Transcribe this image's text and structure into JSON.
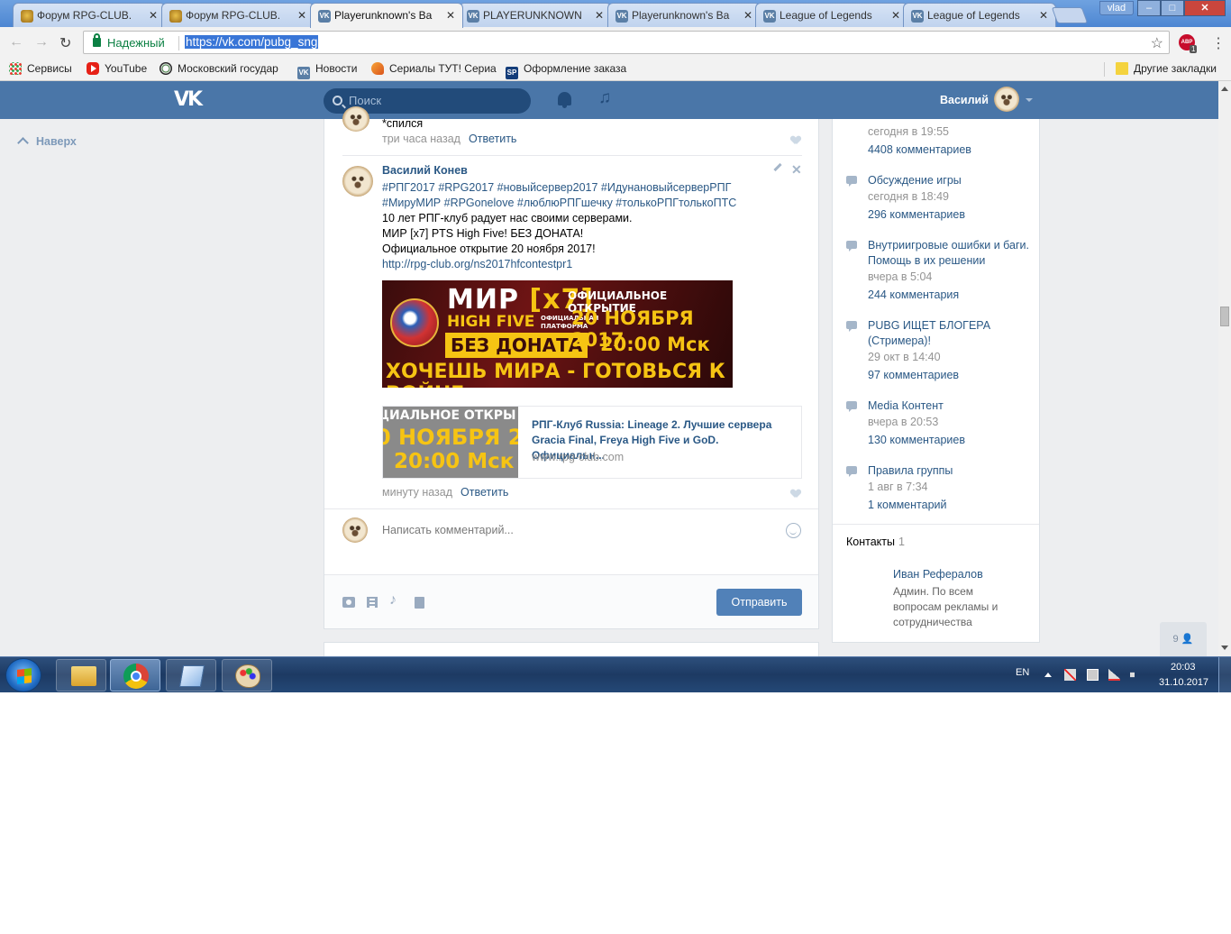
{
  "browser": {
    "tabs": [
      {
        "title": "Форум RPG-CLUB.",
        "icon": "rpg-club-icon"
      },
      {
        "title": "Форум RPG-CLUB.",
        "icon": "rpg-club-icon"
      },
      {
        "title": "Playerunknown's Ba",
        "icon": "vk-icon"
      },
      {
        "title": "PLAYERUNKNOWN",
        "icon": "vk-icon"
      },
      {
        "title": "Playerunknown's Ba",
        "icon": "vk-icon"
      },
      {
        "title": "League of Legends",
        "icon": "vk-icon"
      },
      {
        "title": "League of Legends",
        "icon": "vk-icon"
      }
    ],
    "close_glyph": "✕",
    "profile_name": "vlad",
    "window_controls": {
      "minimize": "–",
      "maximize": "□",
      "close": "✕"
    },
    "address": {
      "secure_label": "Надежный",
      "url": "https://vk.com/pubg_sng"
    },
    "bookmarks": {
      "apps": "Сервисы",
      "youtube": "YouTube",
      "msu": "Московский государ",
      "news": "Новости",
      "serials": "Сериалы ТУТ! Сериа",
      "order": "Оформление заказа",
      "other": "Другие закладки"
    },
    "adblock_label": "ABP",
    "adblock_count": "1"
  },
  "vk": {
    "logo": "VK",
    "search_placeholder": "Поиск",
    "user_name": "Василий",
    "to_top": "Наверх",
    "previous_comment": {
      "text": "*спился",
      "time": "три часа назад",
      "reply": "Ответить"
    },
    "comment": {
      "author": "Василий Конев",
      "tags_line1": "#РПГ2017 #RPG2017 #новыйсервер2017 #ИдунановыйсерверРПГ",
      "tags_line2": "#МируМИР #RPGonelove #люблюРПГшечку #толькоРПГтолькоПТС",
      "line1": "10 лет РПГ-клуб радует нас своими серверами.",
      "line2": "МИР [x7] PTS High Five! БЕЗ ДОНАТА!",
      "line3": "Официальное открытие 20 ноября 2017!",
      "link": "http://rpg-club.org/ns2017hfcontestpr1",
      "banner": {
        "mir": "МИР ",
        "x7": "[x7]",
        "high_five": "HIGH FIVE",
        "platform": "ОФИЦИАЛЬНАЯ ПЛАТФОРМА",
        "no_donate": "БЕЗ ДОНАТА",
        "opening": "ОФИЦИАЛЬНОЕ ОТКРЫТИЕ",
        "date": "20 НОЯБРЯ 2017",
        "time": "20:00 Мск",
        "slogan": "ХОЧЕШЬ МИРА - ГОТОВЬСЯ К ВОЙНЕ"
      },
      "link_preview": {
        "thumb_line1": "ЦИАЛЬНОЕ ОТКРЫ",
        "thumb_line2": "0 НОЯБРЯ 201",
        "thumb_line3": "20:00 Мск",
        "title": "РПГ-Клуб Russia: Lineage 2. Лучшие сервера Gracia Final, Freya High Five и GoD. Официальн...",
        "domain": "www.rpg-club.com"
      },
      "time": "минуту назад",
      "reply": "Ответить"
    },
    "composer": {
      "placeholder": "Написать комментарий...",
      "send": "Отправить"
    },
    "discussions": [
      {
        "title": "",
        "date": "сегодня в 19:55",
        "count": "4408 комментариев"
      },
      {
        "title": "Обсуждение игры",
        "date": "сегодня в 18:49",
        "count": "296 комментариев"
      },
      {
        "title": "Внутриигровые ошибки и баги. Помощь в их решении",
        "date": "вчера в 5:04",
        "count": "244 комментария"
      },
      {
        "title": "PUBG ИЩЕТ БЛОГЕРА (Стримера)!",
        "date": "29 окт в 14:40",
        "count": "97 комментариев"
      },
      {
        "title": "Media Контент",
        "date": "вчера в 20:53",
        "count": "130 комментариев"
      },
      {
        "title": "Правила группы",
        "date": "1 авг в 7:34",
        "count": "1 комментарий"
      }
    ],
    "contacts": {
      "title": "Контакты",
      "count": "1",
      "name": "Иван Рефералов",
      "description": "Админ. По всем вопросам рекламы и сотрудничества"
    },
    "online_count": "9"
  },
  "taskbar": {
    "language": "EN",
    "time": "20:03",
    "date": "31.10.2017"
  },
  "colors": {
    "vk_header": "#4a76a8",
    "vk_link": "#2a5885",
    "vk_button": "#5181b8",
    "page_bg": "#edeef0"
  }
}
